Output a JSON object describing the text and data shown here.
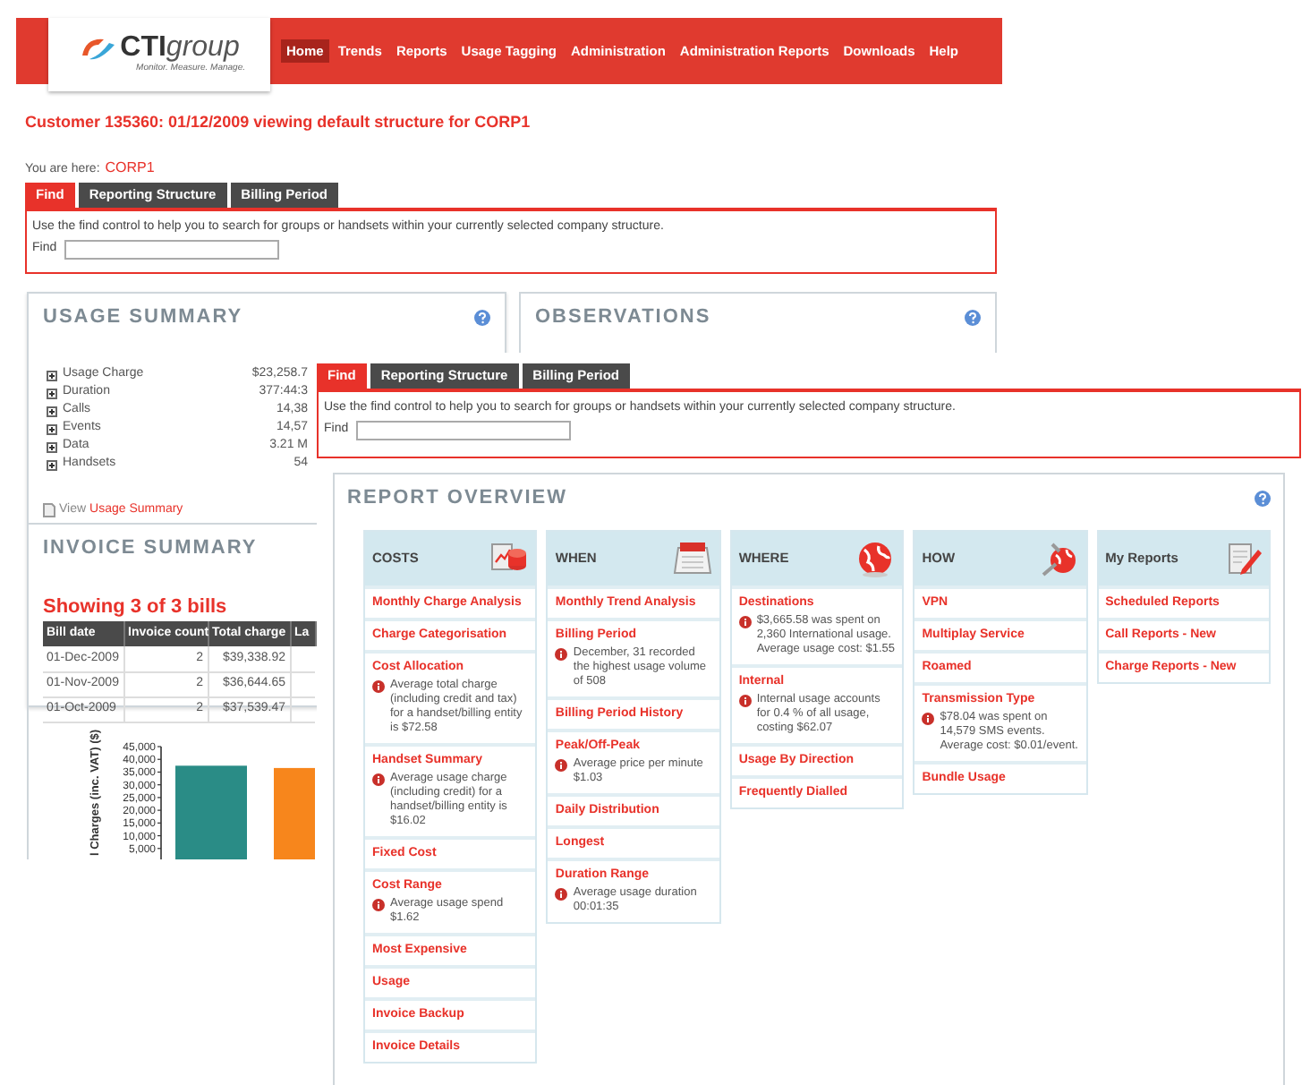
{
  "header": {
    "logo": {
      "brand_bold": "CTI",
      "brand_light": "group",
      "tagline": "Monitor. Measure. Manage."
    },
    "nav": [
      {
        "label": "Home",
        "selected": true
      },
      {
        "label": "Trends",
        "selected": false
      },
      {
        "label": "Reports",
        "selected": false
      },
      {
        "label": "Usage Tagging",
        "selected": false
      },
      {
        "label": "Administration",
        "selected": false
      },
      {
        "label": "Administration Reports",
        "selected": false
      },
      {
        "label": "Downloads",
        "selected": false
      },
      {
        "label": "Help",
        "selected": false
      }
    ]
  },
  "customer_heading": "Customer 135360: 01/12/2009 viewing default structure for CORP1",
  "breadcrumb": {
    "label": "You are here:",
    "current": "CORP1"
  },
  "find_panel": {
    "tabs": [
      {
        "label": "Find",
        "selected": true
      },
      {
        "label": "Reporting Structure",
        "selected": false
      },
      {
        "label": "Billing Period",
        "selected": false
      }
    ],
    "hint": "Use the find control to help you to search for groups or handsets within your currently selected company structure.",
    "find_label": "Find"
  },
  "usage_summary": {
    "title": "USAGE SUMMARY",
    "rows": [
      {
        "label": "Usage Charge",
        "value": "$23,258.7"
      },
      {
        "label": "Duration",
        "value": "377:44:3"
      },
      {
        "label": "Calls",
        "value": "14,38"
      },
      {
        "label": "Events",
        "value": "14,57"
      },
      {
        "label": "Data",
        "value": "3.21 M"
      },
      {
        "label": "Handsets",
        "value": "54"
      }
    ],
    "view_prefix": "View",
    "view_link": "Usage Summary"
  },
  "observations": {
    "title": "OBSERVATIONS"
  },
  "invoice_summary": {
    "title": "INVOICE SUMMARY",
    "showing": "Showing 3 of 3 bills",
    "columns": [
      "Bill date",
      "Invoice count",
      "Total charge",
      "La"
    ],
    "rows": [
      [
        "01-Dec-2009",
        "2",
        "$39,338.92"
      ],
      [
        "01-Nov-2009",
        "2",
        "$36,644.65"
      ],
      [
        "01-Oct-2009",
        "2",
        "$37,539.47"
      ]
    ],
    "chart_data": {
      "type": "bar",
      "ylabel": "l Charges (inc. VAT) ($)",
      "ylim": [
        0,
        45000
      ],
      "yticks": [
        {
          "value": 5000,
          "label": "5,000"
        },
        {
          "value": 10000,
          "label": "10,000"
        },
        {
          "value": 15000,
          "label": "15,000"
        },
        {
          "value": 20000,
          "label": "20,000"
        },
        {
          "value": 25000,
          "label": "25,000"
        },
        {
          "value": 30000,
          "label": "30,000"
        },
        {
          "value": 35000,
          "label": "35,000"
        },
        {
          "value": 40000,
          "label": "40,000"
        },
        {
          "value": 45000,
          "label": "45,000"
        }
      ],
      "series": [
        {
          "color": "#2a8c86",
          "values": [
            37500
          ]
        },
        {
          "color": "#f7861c",
          "values": [
            36600
          ]
        }
      ]
    }
  },
  "overlay": {
    "find_panel": {
      "tabs": [
        {
          "label": "Find",
          "selected": true
        },
        {
          "label": "Reporting Structure",
          "selected": false
        },
        {
          "label": "Billing Period",
          "selected": false
        }
      ],
      "hint": "Use the find control to help you to search for groups or handsets within your currently selected company structure.",
      "find_label": "Find"
    },
    "report_overview": {
      "title": "REPORT OVERVIEW",
      "columns": [
        {
          "title": "COSTS",
          "kind": "costs",
          "items": [
            {
              "label": "Monthly Charge Analysis"
            },
            {
              "label": "Charge Categorisation"
            },
            {
              "label": "Cost Allocation",
              "note": "Average total charge (including credit and tax) for a handset/billing entity is $72.58"
            },
            {
              "label": "Handset Summary",
              "note": "Average usage charge (including credit) for a handset/billing entity is $16.02"
            },
            {
              "label": "Fixed Cost"
            },
            {
              "label": "Cost Range",
              "note": "Average usage spend $1.62"
            },
            {
              "label": "Most Expensive"
            },
            {
              "label": "Usage"
            },
            {
              "label": "Invoice Backup"
            },
            {
              "label": "Invoice Details"
            }
          ]
        },
        {
          "title": "WHEN",
          "kind": "when",
          "items": [
            {
              "label": "Monthly Trend Analysis"
            },
            {
              "label": "Billing Period",
              "note": "December, 31 recorded the highest usage volume of 508"
            },
            {
              "label": "Billing Period History"
            },
            {
              "label": "Peak/Off-Peak",
              "note": "Average price per minute $1.03"
            },
            {
              "label": "Daily Distribution"
            },
            {
              "label": "Longest"
            },
            {
              "label": "Duration Range",
              "note": "Average usage duration 00:01:35"
            }
          ]
        },
        {
          "title": "WHERE",
          "kind": "where",
          "items": [
            {
              "label": "Destinations",
              "note": "$3,665.58 was spent on 2,360 International usage. Average usage cost: $1.55"
            },
            {
              "label": "Internal",
              "note": "Internal usage accounts for 0.4 % of all usage, costing $62.07"
            },
            {
              "label": "Usage By Direction"
            },
            {
              "label": "Frequently Dialled"
            }
          ]
        },
        {
          "title": "HOW",
          "kind": "how",
          "items": [
            {
              "label": "VPN"
            },
            {
              "label": "Multiplay Service"
            },
            {
              "label": "Roamed"
            },
            {
              "label": "Transmission Type",
              "note": "$78.04 was spent on 14,579 SMS events. Average cost: $0.01/event."
            },
            {
              "label": "Bundle Usage"
            }
          ]
        },
        {
          "title": "My Reports",
          "kind": "my_reports",
          "items": [
            {
              "label": "Scheduled Reports"
            },
            {
              "label": "Call Reports - New"
            },
            {
              "label": "Charge Reports - New"
            }
          ]
        }
      ]
    }
  }
}
